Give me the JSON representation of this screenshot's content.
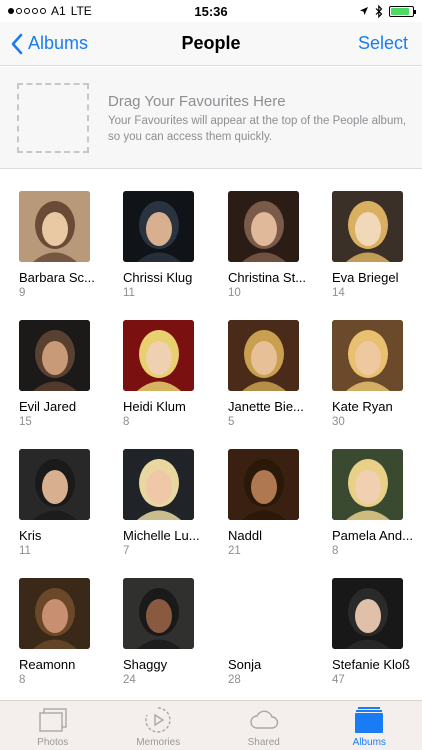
{
  "status_bar": {
    "carrier": "A1",
    "network": "LTE",
    "time": "15:36",
    "battery_level": 0.85
  },
  "nav": {
    "back_label": "Albums",
    "title": "People",
    "select_label": "Select"
  },
  "favourites": {
    "title": "Drag Your Favourites Here",
    "description": "Your Favourites will appear at the top of the People album, so you can access them quickly."
  },
  "people": [
    {
      "name": "Barbara Sc...",
      "count": "9"
    },
    {
      "name": "Chrissi Klug",
      "count": "11"
    },
    {
      "name": "Christina St...",
      "count": "10"
    },
    {
      "name": "Eva Briegel",
      "count": "14"
    },
    {
      "name": "Evil Jared",
      "count": "15"
    },
    {
      "name": "Heidi Klum",
      "count": "8"
    },
    {
      "name": "Janette Bie...",
      "count": "5"
    },
    {
      "name": "Kate Ryan",
      "count": "30"
    },
    {
      "name": "Kris",
      "count": "11"
    },
    {
      "name": "Michelle Lu...",
      "count": "7"
    },
    {
      "name": "Naddl",
      "count": "21"
    },
    {
      "name": "Pamela And...",
      "count": "8"
    },
    {
      "name": "Reamonn",
      "count": "8"
    },
    {
      "name": "Shaggy",
      "count": "24"
    },
    {
      "name": "Sonja",
      "count": "28"
    },
    {
      "name": "Stefanie Kloß",
      "count": "47"
    }
  ],
  "tabs": [
    {
      "label": "Photos",
      "icon": "photos-icon"
    },
    {
      "label": "Memories",
      "icon": "memories-icon"
    },
    {
      "label": "Shared",
      "icon": "cloud-icon"
    },
    {
      "label": "Albums",
      "icon": "albums-icon",
      "active": true
    }
  ],
  "colors": {
    "accent": "#1a7cf5",
    "secondary_text": "#8e8e93",
    "battery": "#4cd964"
  }
}
